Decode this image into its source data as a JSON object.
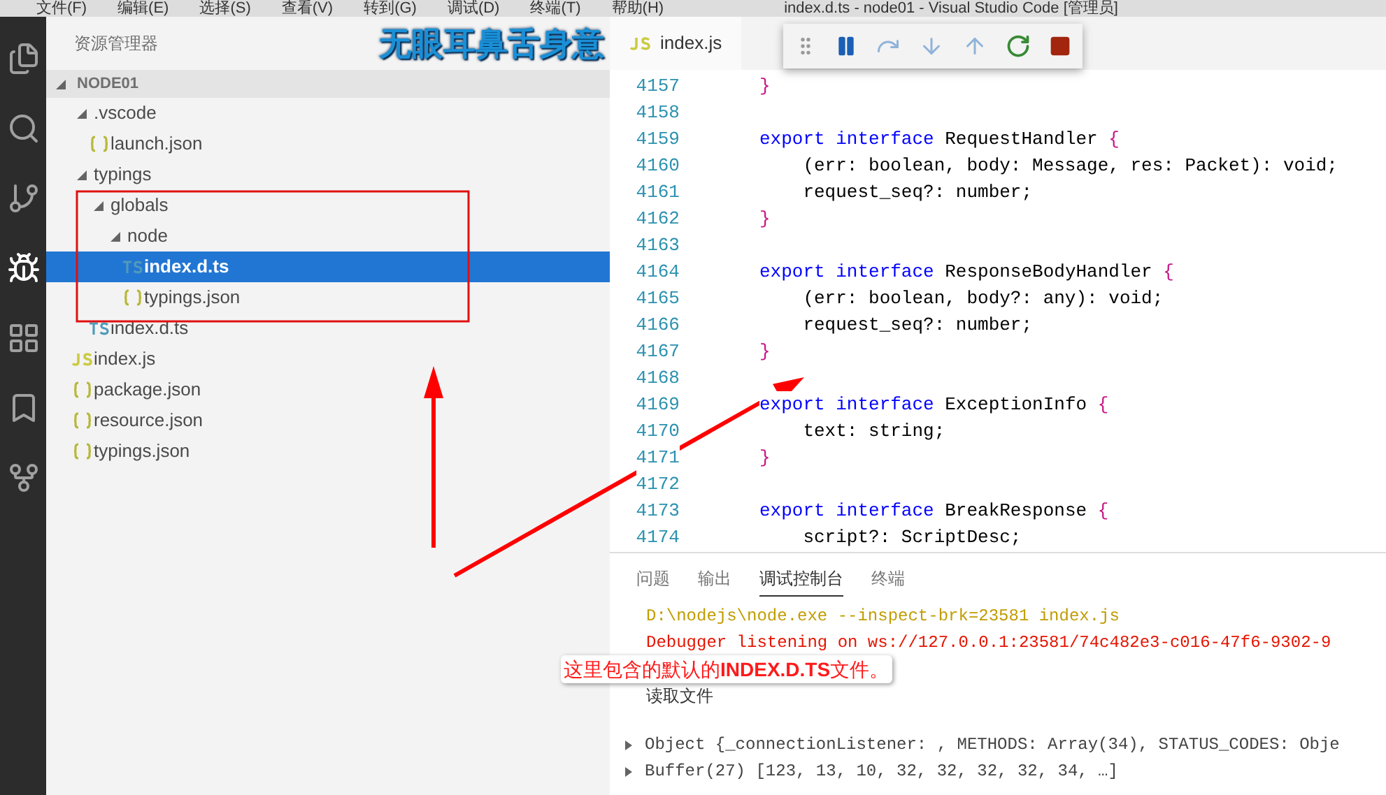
{
  "window": {
    "title": "index.d.ts - node01 - Visual Studio Code [管理员]"
  },
  "menu": [
    "文件(F)",
    "编辑(E)",
    "选择(S)",
    "查看(V)",
    "转到(G)",
    "调试(D)",
    "终端(T)",
    "帮助(H)"
  ],
  "sidebar": {
    "title": "资源管理器",
    "banner": "无眼耳鼻舌身意",
    "root": {
      "label": "NODE01",
      "expanded": true
    },
    "items": [
      {
        "label": ".vscode",
        "kind": "folder",
        "expanded": true,
        "selected": false,
        "children": [
          {
            "label": "launch.json",
            "kind": "json",
            "selected": false
          }
        ]
      },
      {
        "label": "typings",
        "kind": "folder",
        "expanded": true,
        "selected": false,
        "children": [
          {
            "label": "globals",
            "kind": "folder",
            "expanded": true,
            "selected": false,
            "children": [
              {
                "label": "node",
                "kind": "folder",
                "expanded": true,
                "selected": false,
                "children": [
                  {
                    "label": "index.d.ts",
                    "kind": "ts",
                    "selected": true
                  },
                  {
                    "label": "typings.json",
                    "kind": "json",
                    "selected": false
                  }
                ]
              }
            ]
          },
          {
            "label": "index.d.ts",
            "kind": "ts",
            "selected": false
          }
        ]
      },
      {
        "label": "index.js",
        "kind": "js",
        "selected": false
      },
      {
        "label": "package.json",
        "kind": "json",
        "selected": false
      },
      {
        "label": "resource.json",
        "kind": "json",
        "selected": false
      },
      {
        "label": "typings.json",
        "kind": "json",
        "selected": false
      }
    ]
  },
  "editor": {
    "tabs": [
      {
        "label": "index.js",
        "kind": "js",
        "selected": true
      }
    ],
    "lines": [
      {
        "number": "4157",
        "tokens": [
          {
            "text": "}",
            "kind": "brace"
          }
        ]
      },
      {
        "number": "4158"
      },
      {
        "number": "4159",
        "tokens": [
          {
            "text": "export interface",
            "kind": "keyword"
          },
          {
            "text": " RequestHandler ",
            "kind": "plain"
          },
          {
            "text": "{",
            "kind": "brace"
          }
        ]
      },
      {
        "number": "4160",
        "tokens": [
          {
            "text": "    (err: boolean, body: Message, res: Packet): void;",
            "kind": "plain"
          }
        ]
      },
      {
        "number": "4161",
        "tokens": [
          {
            "text": "    request_seq?: number;",
            "kind": "plain"
          }
        ]
      },
      {
        "number": "4162",
        "tokens": [
          {
            "text": "}",
            "kind": "brace"
          }
        ]
      },
      {
        "number": "4163"
      },
      {
        "number": "4164",
        "tokens": [
          {
            "text": "export interface",
            "kind": "keyword"
          },
          {
            "text": " ResponseBodyHandler ",
            "kind": "plain"
          },
          {
            "text": "{",
            "kind": "brace"
          }
        ]
      },
      {
        "number": "4165",
        "tokens": [
          {
            "text": "    (err: boolean, body?: any): void;",
            "kind": "plain"
          }
        ]
      },
      {
        "number": "4166",
        "tokens": [
          {
            "text": "    request_seq?: number;",
            "kind": "plain"
          }
        ]
      },
      {
        "number": "4167",
        "tokens": [
          {
            "text": "}",
            "kind": "brace"
          }
        ]
      },
      {
        "number": "4168"
      },
      {
        "number": "4169",
        "tokens": [
          {
            "text": "export interface",
            "kind": "keyword"
          },
          {
            "text": " ExceptionInfo ",
            "kind": "plain"
          },
          {
            "text": "{",
            "kind": "brace"
          }
        ]
      },
      {
        "number": "4170",
        "tokens": [
          {
            "text": "    text: string;",
            "kind": "plain"
          }
        ]
      },
      {
        "number": "4171",
        "tokens": [
          {
            "text": "}",
            "kind": "brace"
          }
        ]
      },
      {
        "number": "4172"
      },
      {
        "number": "4173",
        "tokens": [
          {
            "text": "export interface",
            "kind": "keyword"
          },
          {
            "text": " BreakResponse ",
            "kind": "plain"
          },
          {
            "text": "{",
            "kind": "brace"
          }
        ]
      },
      {
        "number": "4174",
        "tokens": [
          {
            "text": "    script?: ScriptDesc;",
            "kind": "plain"
          }
        ]
      }
    ]
  },
  "panel": {
    "tabs": [
      {
        "label": "问题",
        "selected": false
      },
      {
        "label": "输出",
        "selected": false
      },
      {
        "label": "调试控制台",
        "selected": true
      },
      {
        "label": "终端",
        "selected": false
      }
    ],
    "console": [
      {
        "text": "D:\\nodejs\\node.exe --inspect-brk=23581 index.js",
        "kind": "command"
      },
      {
        "text": "Debugger listening on ws://127.0.0.1:23581/74c482e3-c016-47f6-9302-9",
        "kind": "error"
      },
      {
        "kind": "hidden"
      },
      {
        "text": "读取文件",
        "kind": "log"
      },
      {
        "kind": "blank"
      },
      {
        "text": "Object {_connectionListener: , METHODS: Array(34), STATUS_CODES: Obje",
        "kind": "object"
      },
      {
        "text": "Buffer(27) [123, 13, 10, 32, 32, 32, 32, 34, …]",
        "kind": "object"
      }
    ]
  },
  "annotation": {
    "callout": "这里包含的默认的**INDEX.D.TS**文件。"
  }
}
